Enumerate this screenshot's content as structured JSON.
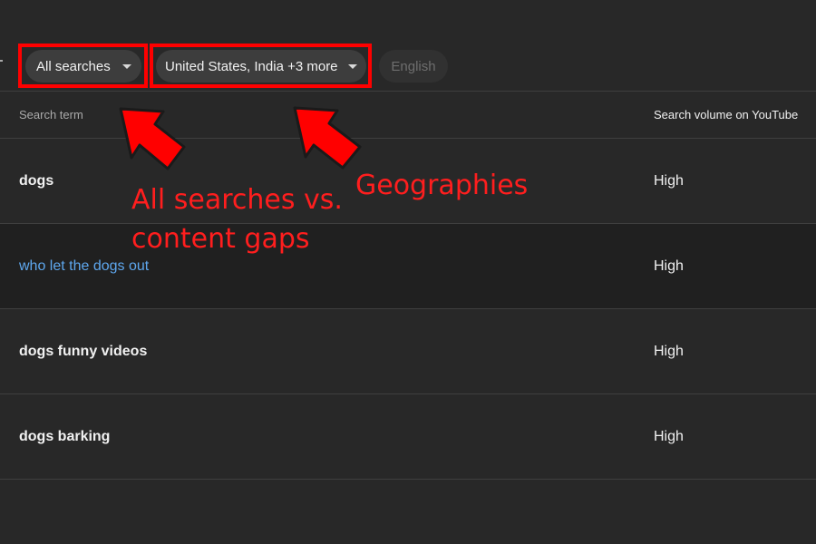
{
  "filters": {
    "searches_label": "All searches",
    "geo_label": "United States, India +3 more",
    "language_label": "English"
  },
  "table": {
    "headers": [
      "Search term",
      "Search volume on YouTube"
    ],
    "rows": [
      {
        "term": "dogs",
        "volume": "High"
      },
      {
        "term": "who let the dogs out",
        "volume": "High"
      },
      {
        "term": "dogs funny videos",
        "volume": "High"
      },
      {
        "term": "dogs barking",
        "volume": "High"
      }
    ]
  },
  "annotations": {
    "searches_note": "All searches vs. content gaps",
    "geo_note": "Geographies"
  },
  "colors": {
    "background": "#282828",
    "annotation": "#ff0000",
    "link": "#5ea7ee"
  }
}
